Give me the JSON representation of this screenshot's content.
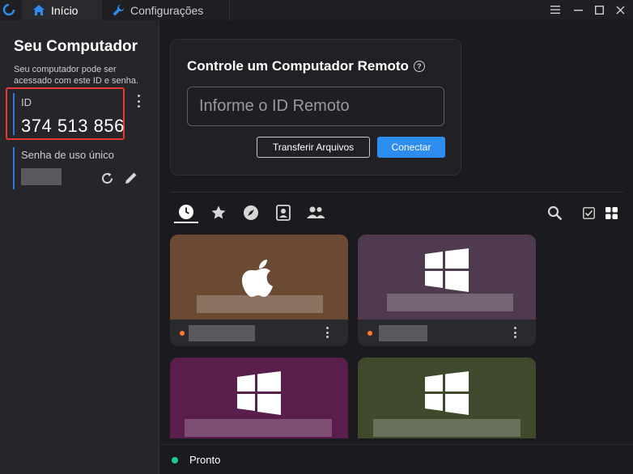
{
  "tabs": [
    {
      "label": "Início",
      "icon": "home-icon"
    },
    {
      "label": "Configurações",
      "icon": "wrench-icon"
    }
  ],
  "window_controls": [
    "menu-icon",
    "minimize-icon",
    "maximize-icon",
    "close-icon"
  ],
  "sidebar": {
    "title": "Seu Computador",
    "description": "Seu computador pode ser acessado com este ID e senha.",
    "id_label": "ID",
    "id_value": "374 513 856",
    "password_label": "Senha de uso único"
  },
  "remote": {
    "title": "Controle um Computador Remoto",
    "input_placeholder": "Informe o ID Remoto",
    "transfer_label": "Transferir Arquivos",
    "connect_label": "Conectar"
  },
  "peer_tabs": [
    "recent-icon",
    "favorites-icon",
    "discovered-icon",
    "address-book-icon",
    "group-icon"
  ],
  "view_controls": [
    "search-icon",
    "select-icon",
    "grid-view-icon"
  ],
  "peers": [
    {
      "os": "macOS",
      "color": "#6b4a34"
    },
    {
      "os": "Windows",
      "color": "#4f3a4f"
    },
    {
      "os": "Windows",
      "color": "#5a1e4c"
    },
    {
      "os": "Windows",
      "color": "#3f4a2c"
    }
  ],
  "status": {
    "text": "Pronto",
    "color": "#20c997"
  },
  "colors": {
    "accent": "#2d8cf0",
    "highlight": "#e53935"
  }
}
